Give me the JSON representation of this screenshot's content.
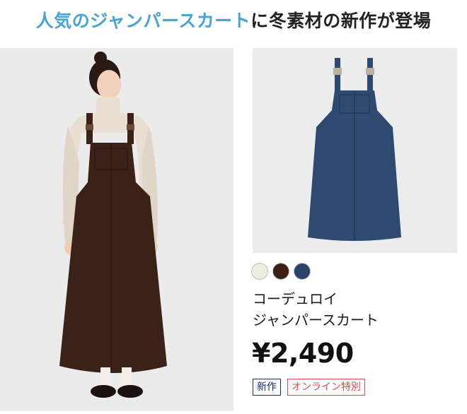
{
  "headline": {
    "accent": "人気のジャンパースカート",
    "rest": "に冬素材の新作が登場"
  },
  "product": {
    "name_line1": "コーデュロイ",
    "name_line2": "ジャンパースカート",
    "price": "¥2,490",
    "badges": {
      "new": "新作",
      "online": "オンライン特別"
    },
    "swatches": [
      {
        "name": "off-white",
        "color": "#f1ece2"
      },
      {
        "name": "dark-brown",
        "color": "#3a1f18"
      },
      {
        "name": "navy",
        "color": "#2a4468"
      }
    ]
  },
  "colors": {
    "accent": "#4aa3d6",
    "badge_new": "#1c2d6b",
    "badge_online": "#e04a4a",
    "dress_brown": "#3b2219",
    "dress_navy": "#2e4a70"
  }
}
